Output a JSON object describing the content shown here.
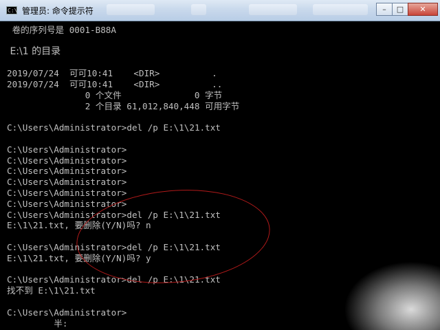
{
  "window": {
    "title": "管理员: 命令提示符",
    "minimize_glyph": "–",
    "maximize_glyph": "□",
    "close_glyph": "✕"
  },
  "console": {
    "lines": [
      " 卷的序列号是 0001-B88A",
      "",
      " E:\\1 的目录",
      "",
      "2019/07/24  可可10:41    <DIR>          .",
      "2019/07/24  可可10:41    <DIR>          ..",
      "               0 个文件              0 字节",
      "               2 个目录 61,012,840,448 可用字节",
      "",
      "C:\\Users\\Administrator>del /p E:\\1\\21.txt",
      "",
      "C:\\Users\\Administrator>",
      "C:\\Users\\Administrator>",
      "C:\\Users\\Administrator>",
      "C:\\Users\\Administrator>",
      "C:\\Users\\Administrator>",
      "C:\\Users\\Administrator>",
      "C:\\Users\\Administrator>del /p E:\\1\\21.txt",
      "E:\\1\\21.txt, 要删除(Y/N)吗? n",
      "",
      "C:\\Users\\Administrator>del /p E:\\1\\21.txt",
      "E:\\1\\21.txt, 要删除(Y/N)吗? y",
      "",
      "C:\\Users\\Administrator>del /p E:\\1\\21.txt",
      "找不到 E:\\1\\21.txt",
      "",
      "C:\\Users\\Administrator>",
      "         半:"
    ]
  },
  "colors": {
    "console_bg": "#000000",
    "console_text": "#c0c0c0",
    "annotation_ellipse": "#b21a1a"
  }
}
